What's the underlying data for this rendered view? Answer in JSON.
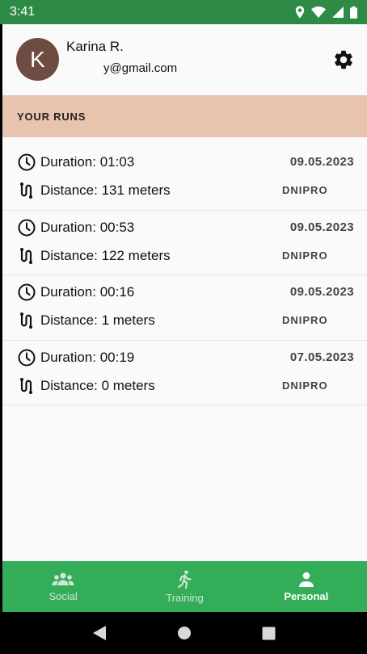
{
  "status_bar": {
    "time": "3:41"
  },
  "profile": {
    "avatar_letter": "K",
    "name": "Karina R.",
    "email": "y@gmail.com",
    "avatar_color": "#6d4c41"
  },
  "section": {
    "title": "YOUR RUNS"
  },
  "runs": [
    {
      "duration": "Duration: 01:03",
      "distance": "Distance: 131 meters",
      "date": "09.05.2023",
      "city": "DNIPRO"
    },
    {
      "duration": "Duration: 00:53",
      "distance": "Distance: 122 meters",
      "date": "09.05.2023",
      "city": "DNIPRO"
    },
    {
      "duration": "Duration: 00:16",
      "distance": "Distance: 1 meters",
      "date": "09.05.2023",
      "city": "DNIPRO"
    },
    {
      "duration": "Duration: 00:19",
      "distance": "Distance: 0 meters",
      "date": "07.05.2023",
      "city": "DNIPRO"
    }
  ],
  "bottom_nav": {
    "tabs": [
      {
        "label": "Social",
        "icon": "people-icon"
      },
      {
        "label": "Training",
        "icon": "runner-icon"
      },
      {
        "label": "Personal",
        "icon": "person-icon",
        "active": true
      }
    ]
  },
  "colors": {
    "primary": "#33ad57",
    "status_bar": "#2e8b46",
    "section_bg": "#e8c4ae"
  }
}
